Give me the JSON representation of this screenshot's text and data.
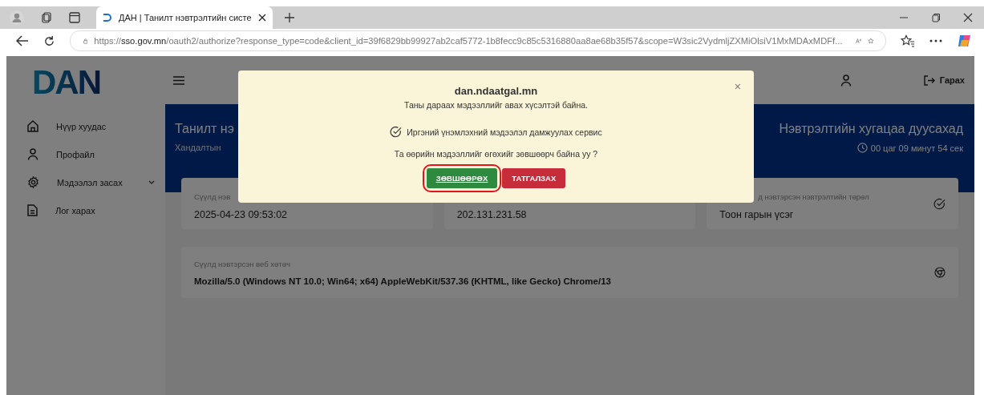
{
  "browser": {
    "tab": {
      "title": "ДАН | Танилт нэвтрэлтийн систе",
      "selected": true
    },
    "url": "https://**sso.gov.mn**/oauth2/authorize?response_type=code&client_id=39f6829bb99927ab2caf5772-1b8fecc9c85c5316880aa8ae68b35f57&scope=W3sic2VydmljZXMiOlsiV1MxMDAxMDFf..."
  },
  "logo": "DAN",
  "sidebar": {
    "items": [
      {
        "label": "Нүүр хуудас"
      },
      {
        "label": "Профайл"
      },
      {
        "label": "Мэдээлэл засах",
        "expanded": false
      },
      {
        "label": "Лог харах"
      }
    ]
  },
  "header": {
    "logout": "Гарах"
  },
  "hero": {
    "title": "Танилт нэ",
    "subtitle": "Хандалтын",
    "timer_title": "Нэвтрэлтийн хугацаа дуусахад",
    "timer": "00 цаг 09 минут 54 сек"
  },
  "cards": [
    {
      "label": "Сүүлд нэв",
      "value": "2025-04-23 09:53:02"
    },
    {
      "value": "202.131.231.58"
    },
    {
      "label": "д нэвтэрсэн нэвтрэлтийн төрөл",
      "value": "Тоон гарын үсэг"
    }
  ],
  "browser_card": {
    "label": "Сүүлд нэвтэрсэн веб хөтөч",
    "value": "Mozilla/5.0 (Windows NT 10.0; Win64; x64) AppleWebKit/537.36 (KHTML, like Gecko) Chrome/13"
  },
  "modal": {
    "title": "dan.ndaatgal.mn",
    "close": "×",
    "message": "Таны дараах мэдээллийг авах хүсэлтэй байна.",
    "scopes": [
      {
        "label": "Иргэний үнэмлэхний мэдээлэл дамжуулах сервис",
        "checked": true
      }
    ],
    "question": "Та өөрийн мэдээллийг өгөхийг зөвшөөрч байна уу ?",
    "buttons": [
      {
        "kind": "accept",
        "label": "ЗӨВШӨӨРӨХ",
        "highlighted": true
      },
      {
        "kind": "decline",
        "label": "ТАТГАЛЗАХ",
        "highlighted": false
      }
    ]
  }
}
